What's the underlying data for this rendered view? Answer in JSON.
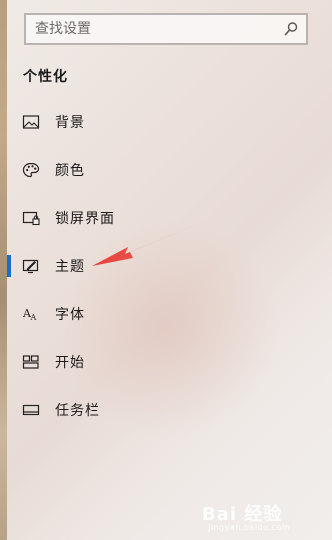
{
  "search": {
    "placeholder": "查找设置",
    "icon": "search-icon"
  },
  "section_title": "个性化",
  "nav": {
    "items": [
      {
        "id": "background",
        "label": "背景",
        "icon": "picture-icon",
        "active": false
      },
      {
        "id": "colors",
        "label": "颜色",
        "icon": "palette-icon",
        "active": false
      },
      {
        "id": "lockscreen",
        "label": "锁屏界面",
        "icon": "lockscreen-icon",
        "active": false
      },
      {
        "id": "themes",
        "label": "主题",
        "icon": "theme-icon",
        "active": true
      },
      {
        "id": "fonts",
        "label": "字体",
        "icon": "font-icon",
        "active": false
      },
      {
        "id": "start",
        "label": "开始",
        "icon": "start-icon",
        "active": false
      },
      {
        "id": "taskbar",
        "label": "任务栏",
        "icon": "taskbar-icon",
        "active": false
      }
    ]
  },
  "annotation": {
    "type": "red-arrow",
    "points_to": "主题",
    "color": "#e8423a"
  },
  "watermark": {
    "brand": "Bai 经验",
    "url": "jingyan.baidu.com"
  },
  "colors": {
    "accent": "#1670c9",
    "text": "#1a1a1a",
    "arrow": "#e8423a"
  }
}
